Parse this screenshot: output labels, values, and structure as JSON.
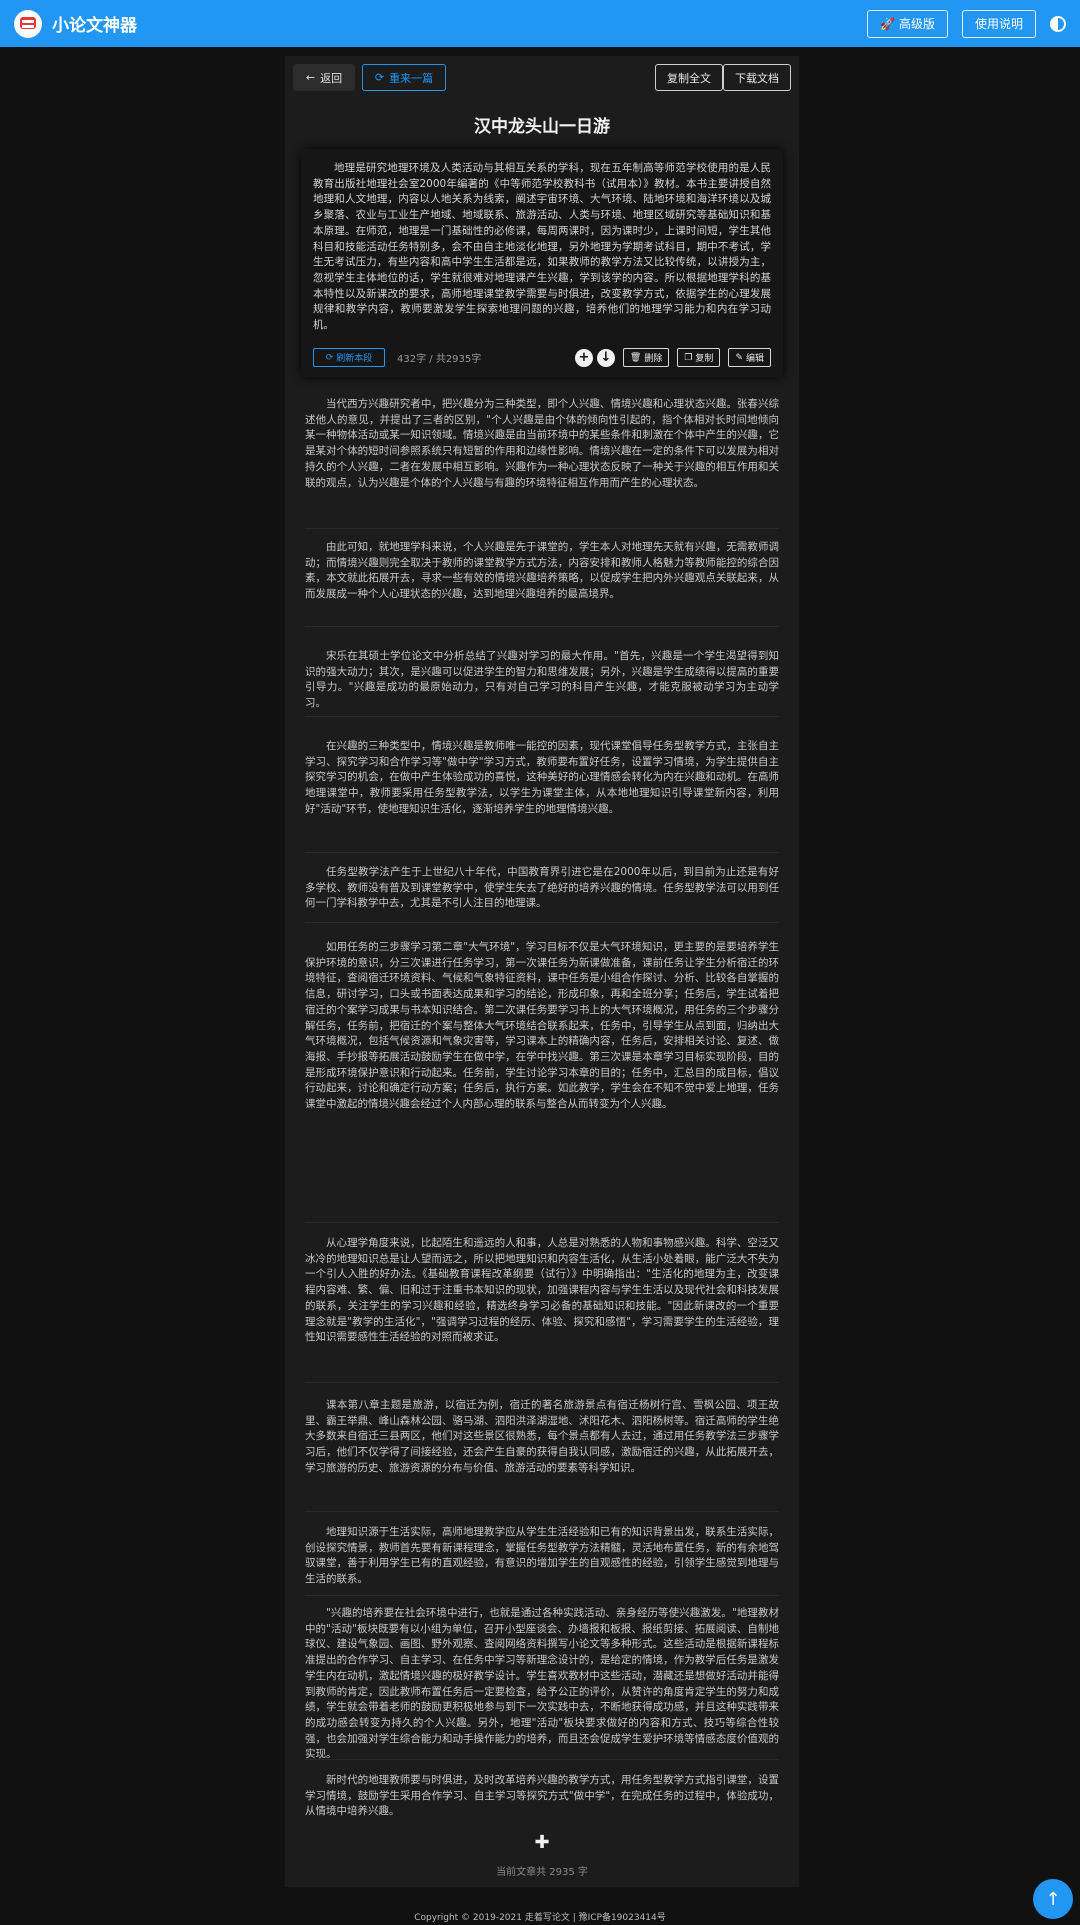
{
  "app": {
    "name": "小论文神器",
    "pro_label": "高级版",
    "help_label": "使用说明"
  },
  "toolbar": {
    "back_label": "返回",
    "retry_label": "重来一篇",
    "copy_all_label": "复制全文",
    "download_label": "下载文档"
  },
  "article": {
    "title": "汉中龙头山一日游",
    "paragraphs": [
      "地理是研究地理环境及人类活动与其相互关系的学科，现在五年制高等师范学校使用的是人民教育出版社地理社会室2000年编著的《中等师范学校教科书（试用本）》教材。本书主要讲授自然地理和人文地理，内容以人地关系为线索，阐述宇宙环境、大气环境、陆地环境和海洋环境以及城乡聚落、农业与工业生产地域、地域联系、旅游活动、人类与环境、地理区域研究等基础知识和基本原理。在师范，地理是一门基础性的必修课，每周两课时，因为课时少，上课时间短，学生其他科目和技能活动任务特别多，会不由自主地淡化地理，另外地理为学期考试科目，期中不考试，学生无考试压力，有些内容和高中学生生活都是远，如果教师的教学方法又比较传统，以讲授为主，忽视学生主体地位的话，学生就很难对地理课产生兴趣，学到该学的内容。所以根据地理学科的基本特性以及新课改的要求，高师地理课堂教学需要与时俱进，改变教学方式，依据学生的心理发展规律和教学内容，教师要激发学生探索地理问题的兴趣，培养他们的地理学习能力和内在学习动机。",
      "当代西方兴趣研究者中，把兴趣分为三种类型，即个人兴趣、情境兴趣和心理状态兴趣。张春兴综述他人的意见，并提出了三者的区别，\"个人兴趣是由个体的倾向性引起的，指个体相对长时间地倾向某一种物体活动或某一知识领域。情境兴趣是由当前环境中的某些条件和刺激在个体中产生的兴趣，它是某对个体的短时间参照系统只有短暂的作用和边缘性影响。情境兴趣在一定的条件下可以发展为相对持久的个人兴趣，二者在发展中相互影响。兴趣作为一种心理状态反映了一种关于兴趣的相互作用和关联的观点，认为兴趣是个体的个人兴趣与有趣的环境特征相互作用而产生的心理状态。",
      "由此可知，就地理学科来说，个人兴趣是先于课堂的，学生本人对地理先天就有兴趣，无需教师调动；而情境兴趣则完全取决于教师的课堂教学方式方法，内容安排和教师人格魅力等教师能控的综合因素，本文就此拓展开去，寻求一些有效的情境兴趣培养策略，以促成学生把内外兴趣观点关联起来，从而发展成一种个人心理状态的兴趣，达到地理兴趣培养的最高境界。",
      "宋乐在其硕士学位论文中分析总结了兴趣对学习的最大作用。\"首先，兴趣是一个学生渴望得到知识的强大动力；其次，是兴趣可以促进学生的智力和思维发展；另外，兴趣是学生成绩得以提高的重要引导力。\"兴趣是成功的最原始动力，只有对自己学习的科目产生兴趣，才能克服被动学习为主动学习。",
      "在兴趣的三种类型中，情境兴趣是教师唯一能控的因素，现代课堂倡导任务型教学方式，主张自主学习、探究学习和合作学习等\"做中学\"学习方式，教师要布置好任务，设置学习情境，为学生提供自主探究学习的机会，在做中产生体验成功的喜悦，这种美好的心理情感会转化为内在兴趣和动机。在高师地理课堂中，教师要采用任务型教学法，以学生为课堂主体，从本地地理知识引导课堂新内容，利用好\"活动\"环节，使地理知识生活化，逐渐培养学生的地理情境兴趣。",
      "任务型教学法产生于上世纪八十年代，中国教育界引进它是在2000年以后，到目前为止还是有好多学校、教师没有普及到课堂教学中，使学生失去了绝好的培养兴趣的情境。任务型教学法可以用到任何一门学科教学中去，尤其是不引人注目的地理课。",
      "如用任务的三步骤学习第二章\"大气环境\"，学习目标不仅是大气环境知识，更主要的是要培养学生保护环境的意识，分三次课进行任务学习，第一次课任务为新课做准备，课前任务让学生分析宿迁的环境特征，查阅宿迁环境资料、气候和气象特征资料，课中任务是小组合作探讨、分析、比较各自掌握的信息，研讨学习，口头或书面表达成果和学习的结论，形成印象，再和全班分享；任务后，学生试着把宿迁的个案学习成果与书本知识结合。第二次课任务要学习书上的大气环境概况，用任务的三个步骤分解任务，任务前，把宿迁的个案与整体大气环境结合联系起来，任务中，引导学生从点到面，归纳出大气环境概况，包括气候资源和气象灾害等，学习课本上的精确内容，任务后，安排相关讨论、复述、做海报、手抄报等拓展活动鼓励学生在做中学，在学中找兴趣。第三次课是本章学习目标实现阶段，目的是形成环境保护意识和行动起来。任务前，学生讨论学习本章的目的；任务中，汇总目的成目标，倡议行动起来，讨论和确定行动方案；任务后，执行方案。如此教学，学生会在不知不觉中爱上地理，任务课堂中激起的情境兴趣会经过个人内部心理的联系与整合从而转变为个人兴趣。",
      "从心理学角度来说，比起陌生和遥远的人和事，人总是对熟悉的人物和事物感兴趣。科学、空泛又冰冷的地理知识总是让人望而远之，所以把地理知识和内容生活化，从生活小处着眼，能广泛大不失为一个引人入胜的好办法。《基础教育课程改革纲要（试行）》中明确指出：\"生活化的地理为主，改变课程内容难、繁、偏、旧和过于注重书本知识的现状，加强课程内容与学生生活以及现代社会和科技发展的联系，关注学生的学习兴趣和经验，精选终身学习必备的基础知识和技能。\"因此新课改的一个重要理念就是\"教学的生活化\"，\"强调学习过程的经历、体验、探究和感悟\"，学习需要学生的生活经验，理性知识需要感性生活经验的对照而被求证。",
      "课本第八章主题是旅游，以宿迁为例，宿迁的著名旅游景点有宿迁杨树行宫、雪枫公园、项王故里、霸王举鼎、峰山森林公园、骆马湖、泗阳洪泽湖湿地、沭阳花木、泗阳杨树等。宿迁高师的学生绝大多数来自宿迁三县两区，他们对这些景区很熟悉，每个景点都有人去过，通过用任务教学法三步骤学习后，他们不仅学得了间接经验，还会产生自豪的获得自我认同感，激励宿迁的兴趣，从此拓展开去，学习旅游的历史、旅游资源的分布与价值、旅游活动的要素等科学知识。",
      "地理知识源于生活实际，高师地理教学应从学生生活经验和已有的知识背景出发，联系生活实际，创设探究情景，教师首先要有新课程理念，掌握任务型教学方法精髓，灵活地布置任务，新的有余地驾驭课堂，善于利用学生已有的直观经验，有意识的增加学生的自观感性的经验，引领学生感觉到地理与生活的联系。",
      "\"兴趣的培养要在社会环境中进行，也就是通过各种实践活动、亲身经历等使兴趣激发。\"地理教材中的\"活动\"板块既要有以小组为单位，召开小型座谈会、办墙报和板报、报纸剪接、拓展阅读、自制地球仪、建设气象园、画图、野外观察、查阅网络资料撰写小论文等多种形式。这些活动是根据新课程标准提出的合作学习、自主学习、在任务中学习等新理念设计的，是给定的情境，作为教学后任务是激发学生内在动机，激起情境兴趣的极好教学设计。学生喜欢教材中这些活动，潜藏还是想做好活动并能得到教师的肯定，因此教师布置任务后一定要检查，给予公正的评价，从赞许的角度肯定学生的努力和成绩，学生就会带着老师的鼓励更积极地参与到下一次实践中去，不断地获得成功感，并且这种实践带来的成功感会转变为持久的个人兴趣。另外，地理\"活动\"板块要求做好的内容和方式、技巧等综合性较强，也会加强对学生综合能力和动手操作能力的培养，而且还会促成学生爱护环境等情感态度价值观的实现。",
      "新时代的地理教师要与时俱进，及时改革培养兴趣的教学方式，用任务型教学方式指引课堂，设置学习情境，鼓励学生采用合作学习、自主学习等探究方式\"做中学\"，在完成任务的过程中，体验成功，从情境中培养兴趣。"
    ]
  },
  "card": {
    "refresh_label": "刷新本段",
    "count_text": "432字 / 共2935字",
    "delete_label": "删除",
    "copy_label": "复制",
    "edit_label": "编辑"
  },
  "summary": {
    "total_text": "当前文章共 2935 字"
  },
  "footer": {
    "copyright": "Copyright © 2019-2021 走着写论文 | 豫ICP备19023414号"
  },
  "colors": {
    "primary": "#2196f3",
    "page_bg": "#111111",
    "panel_bg": "#1c1c1c"
  },
  "icons": [
    "logo-icon",
    "rocket-icon",
    "theme-toggle-icon",
    "arrow-left-icon",
    "refresh-icon",
    "copy-icon",
    "download-icon",
    "plus-icon",
    "arrow-down-icon",
    "trash-icon",
    "pencil-icon",
    "arrow-up-icon"
  ]
}
